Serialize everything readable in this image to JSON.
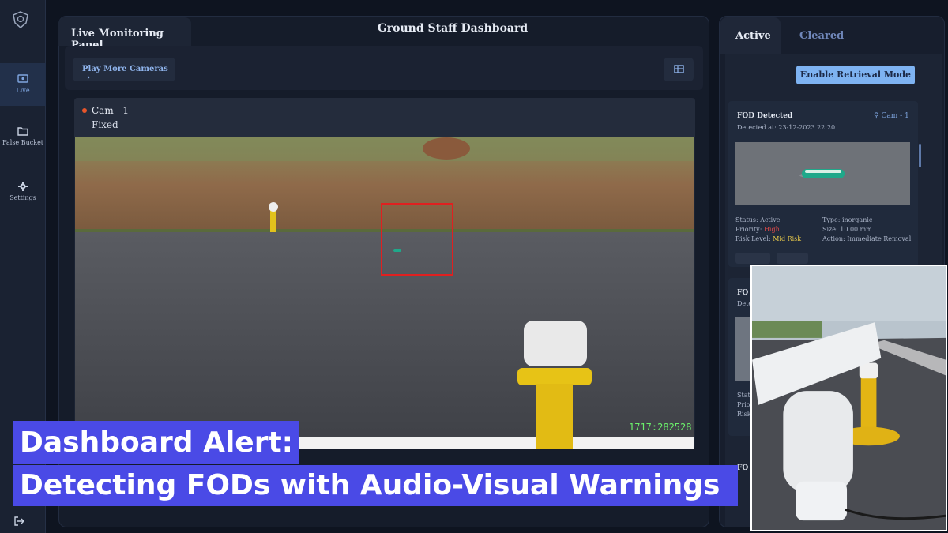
{
  "sidebar": {
    "items": [
      {
        "label": "Live",
        "icon": "live-icon",
        "active": true
      },
      {
        "label": "False Bucket",
        "icon": "folder-icon",
        "active": false
      },
      {
        "label": "Settings",
        "icon": "gear-icon",
        "active": false
      }
    ],
    "logout_icon": "logout-icon",
    "logo_icon": "shield-logo-icon"
  },
  "header": {
    "tab_label": "Live Monitoring Panel",
    "title": "Ground Staff Dashboard"
  },
  "toolbar": {
    "play_more_label": "Play More Cameras",
    "play_more_icon": "chevron-right-icon",
    "grid_icon": "grid-view-icon"
  },
  "camera": {
    "name": "Cam - 1",
    "mode": "Fixed",
    "status_color": "#e7552a",
    "timestamp": "1717:282528"
  },
  "right_panel": {
    "tabs": [
      {
        "label": "Active",
        "active": true
      },
      {
        "label": "Cleared",
        "active": false
      }
    ],
    "retrieval_button": "Enable Retrieval Mode",
    "alert": {
      "title": "FOD Detected",
      "camera": "Cam - 1",
      "detected_at": "Detected at: 23-12-2023 22:20",
      "status": "Status: Active",
      "priority_label": "Priority:",
      "priority_value": "High",
      "risk_label": "Risk Level:",
      "risk_value": "Mid Risk",
      "type": "Type: inorganic",
      "size": "Size: 10.00 mm",
      "action": "Action: Immediate Removal"
    },
    "alert2": {
      "title": "FO",
      "detected": "Dete",
      "status": "Statu",
      "priority": "Prior",
      "risk": "Risk"
    },
    "alert3": {
      "title": "FO"
    }
  },
  "caption": {
    "line1": "Dashboard Alert:",
    "line2": "Detecting FODs with Audio-Visual Warnings",
    "color": "#4a4ae6"
  }
}
